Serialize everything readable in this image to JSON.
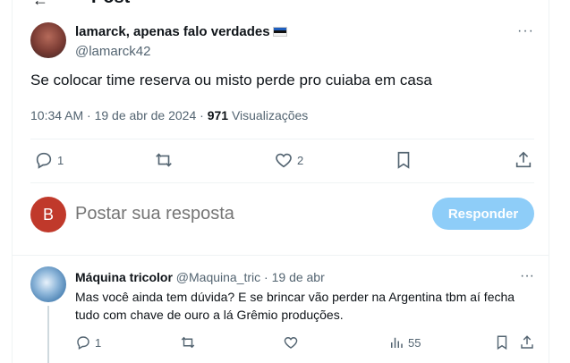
{
  "header": {
    "title": "Post"
  },
  "tweet": {
    "display_name": "lamarck, apenas falo verdades",
    "handle": "@lamarck42",
    "text": "Se colocar time reserva ou misto perde pro cuiaba em casa",
    "time_date": "10:34 AM · 19 de abr de 2024 · ",
    "views_count": "971",
    "views_label": " Visualizações",
    "replies": "1",
    "likes": "2"
  },
  "reply_box": {
    "avatar_letter": "B",
    "placeholder": "Postar sua resposta",
    "button_label": "Responder"
  },
  "comment": {
    "name": "Máquina tricolor",
    "meta": " @Maquina_tric · 19 de abr",
    "text": "Mas você ainda tem dúvida? E se brincar vão perder na Argentina tbm aí fecha tudo com chave de ouro a lá Grêmio produções.",
    "replies": "1",
    "views": "55"
  },
  "icons": [
    "back-arrow-icon",
    "more-icon",
    "reply-icon",
    "retweet-icon",
    "like-icon",
    "bookmark-icon",
    "share-icon",
    "views-icon"
  ],
  "colors": {
    "accent_disabled": "#8ecdf8",
    "muted": "#536471",
    "text": "#0f1419"
  }
}
